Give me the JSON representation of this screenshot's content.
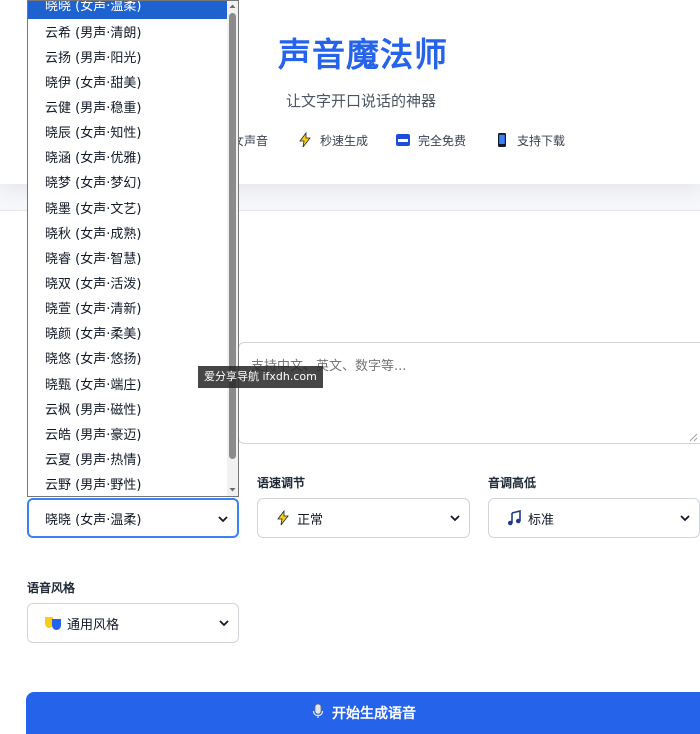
{
  "header": {
    "title": "声音魔法师",
    "subtitle": "让文字开口说话的神器",
    "features": [
      {
        "label": "女声音",
        "icon": "sound-icon"
      },
      {
        "label": "秒速生成",
        "icon": "lightning-icon"
      },
      {
        "label": "完全免费",
        "icon": "free-badge-icon"
      },
      {
        "label": "支持下载",
        "icon": "phone-icon"
      }
    ]
  },
  "text_input": {
    "placeholder": "支持中文、英文、数字等..."
  },
  "voice_select": {
    "value": "晓晓 (女声·温柔)",
    "options": [
      "晓晓 (女声·温柔)",
      "云希 (男声·清朗)",
      "云扬 (男声·阳光)",
      "晓伊 (女声·甜美)",
      "云健 (男声·稳重)",
      "晓辰 (女声·知性)",
      "晓涵 (女声·优雅)",
      "晓梦 (女声·梦幻)",
      "晓墨 (女声·文艺)",
      "晓秋 (女声·成熟)",
      "晓睿 (女声·智慧)",
      "晓双 (女声·活泼)",
      "晓萱 (女声·清新)",
      "晓颜 (女声·柔美)",
      "晓悠 (女声·悠扬)",
      "晓甄 (女声·端庄)",
      "云枫 (男声·磁性)",
      "云皓 (男声·豪迈)",
      "云夏 (男声·热情)",
      "云野 (男声·野性)"
    ]
  },
  "speed": {
    "label": "语速调节",
    "value": "正常",
    "icon": "lightning-icon"
  },
  "pitch": {
    "label": "音调高低",
    "value": "标准",
    "icon": "music-note-icon"
  },
  "style": {
    "label": "语音风格",
    "value": "通用风格",
    "icon": "theater-masks-icon"
  },
  "generate_button": {
    "label": "开始生成语音",
    "icon": "microphone-icon"
  },
  "watermark": {
    "text": "爱分享导航 ifxdh.com"
  },
  "colors": {
    "accent": "#2563eb",
    "selected_option": "#1e62d0"
  }
}
